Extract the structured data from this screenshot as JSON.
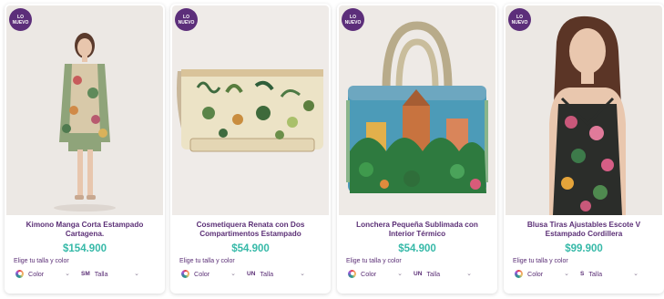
{
  "badge": {
    "line1": "LO",
    "line2": "NUEVO"
  },
  "colors": {
    "brand": "#5c2e7a",
    "price": "#36b9a8"
  },
  "products": [
    {
      "title": "Kimono Manga Corta Estampado Cartagena.",
      "price": "$154.900",
      "choose_label": "Elige tu talla y color",
      "color_label": "Color",
      "size_abbr": "SM",
      "size_label": "Talla",
      "image": "woman-floral-kimono-photo"
    },
    {
      "title": "Cosmetiquera Renata con Dos Compartimentos Estampado",
      "price": "$54.900",
      "choose_label": "Elige tu talla y color",
      "color_label": "Color",
      "size_abbr": "UN",
      "size_label": "Talla",
      "image": "botanical-cosmetic-bag-photo"
    },
    {
      "title": "Lonchera Pequeña Sublimada con Interior Térmico",
      "price": "$54.900",
      "choose_label": "Elige tu talla y color",
      "color_label": "Color",
      "size_abbr": "UN",
      "size_label": "Talla",
      "image": "printed-lunch-bag-photo"
    },
    {
      "title": "Blusa Tiras Ajustables Escote V Estampado Cordillera",
      "price": "$99.900",
      "choose_label": "Elige tu talla y color",
      "color_label": "Color",
      "size_abbr": "S",
      "size_label": "Talla",
      "image": "woman-floral-blouse-photo"
    }
  ]
}
